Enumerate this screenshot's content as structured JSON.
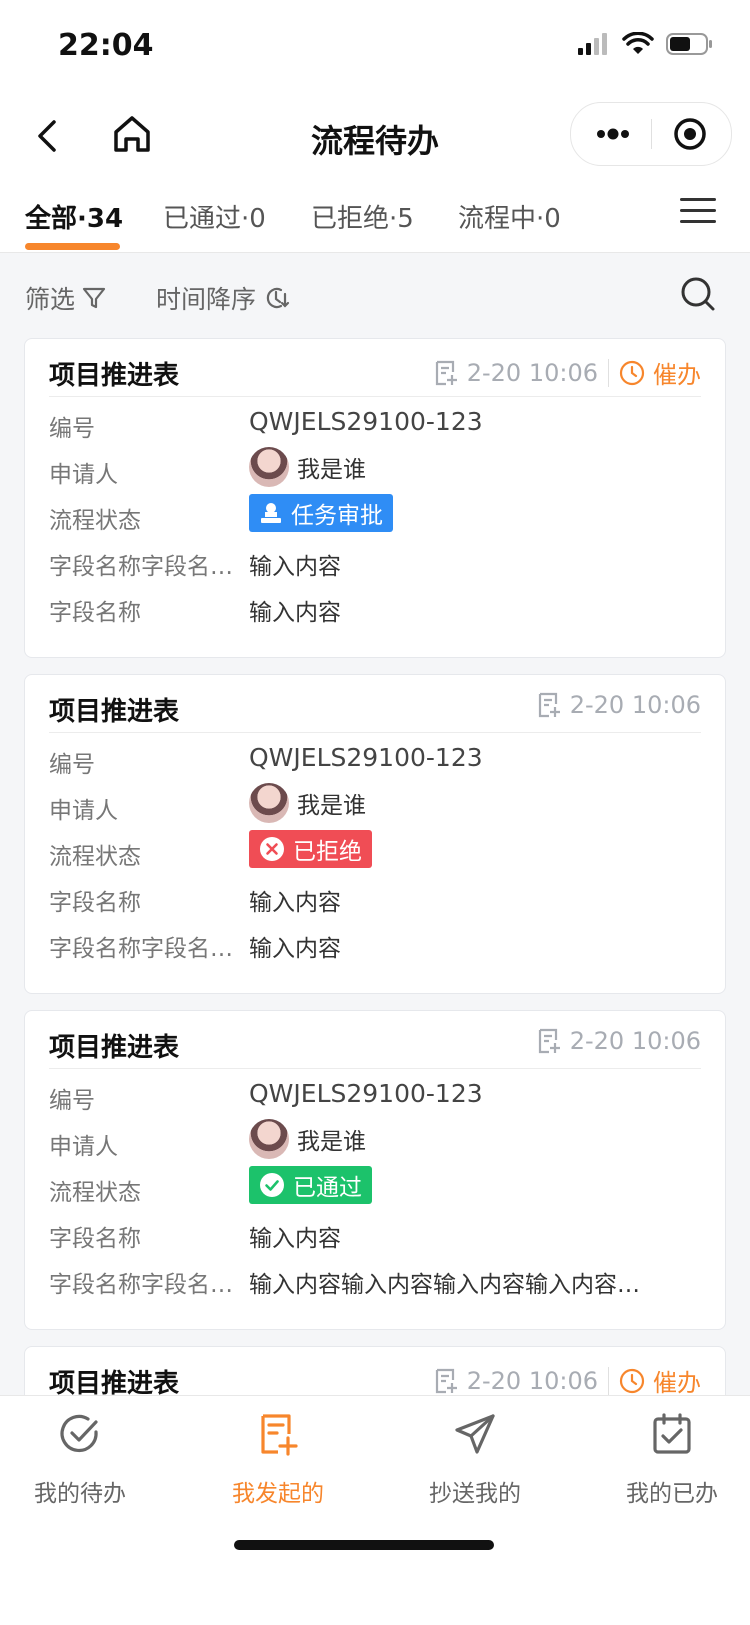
{
  "status_bar": {
    "time": "22:04"
  },
  "nav": {
    "title": "流程待办"
  },
  "tabs": [
    {
      "label": "全部·34",
      "active": true
    },
    {
      "label": "已通过·0",
      "active": false
    },
    {
      "label": "已拒绝·5",
      "active": false
    },
    {
      "label": "流程中·0",
      "active": false
    }
  ],
  "filters": {
    "filter_label": "筛选",
    "sort_label": "时间降序"
  },
  "cards": [
    {
      "title": "项目推进表",
      "time": "2-20 10:06",
      "urge_label": "催办",
      "rows": [
        {
          "label": "编号",
          "value": "QWJELS29100-123"
        },
        {
          "label": "申请人",
          "value": "我是谁"
        },
        {
          "label": "流程状态",
          "value": "任务审批"
        },
        {
          "label": "字段名称字段名称字段名称",
          "value": "输入内容"
        },
        {
          "label": "字段名称",
          "value": "输入内容"
        }
      ]
    },
    {
      "title": "项目推进表",
      "time": "2-20 10:06",
      "rows": [
        {
          "label": "编号",
          "value": "QWJELS29100-123"
        },
        {
          "label": "申请人",
          "value": "我是谁"
        },
        {
          "label": "流程状态",
          "value": "已拒绝"
        },
        {
          "label": "字段名称",
          "value": "输入内容"
        },
        {
          "label": "字段名称字段名称字段名称",
          "value": "输入内容"
        }
      ]
    },
    {
      "title": "项目推进表",
      "time": "2-20 10:06",
      "rows": [
        {
          "label": "编号",
          "value": "QWJELS29100-123"
        },
        {
          "label": "申请人",
          "value": "我是谁"
        },
        {
          "label": "流程状态",
          "value": "已通过"
        },
        {
          "label": "字段名称",
          "value": "输入内容"
        },
        {
          "label": "字段名称字段名称字段名称",
          "value": "输入内容输入内容输入内容输入内容输入内容"
        }
      ]
    },
    {
      "title": "项目推进表",
      "time": "2-20 10:06",
      "urge_label": "催办"
    }
  ],
  "bottom_nav": [
    {
      "label": "我的待办",
      "icon": "check-circle-icon"
    },
    {
      "label": "我发起的",
      "icon": "doc-add-icon",
      "active": true
    },
    {
      "label": "抄送我的",
      "icon": "paper-plane-icon"
    },
    {
      "label": "我的已办",
      "icon": "calendar-check-icon"
    }
  ],
  "colors": {
    "accent": "#f7862c",
    "blue": "#2f8df5",
    "red": "#f04d55",
    "green": "#1cc26b"
  }
}
